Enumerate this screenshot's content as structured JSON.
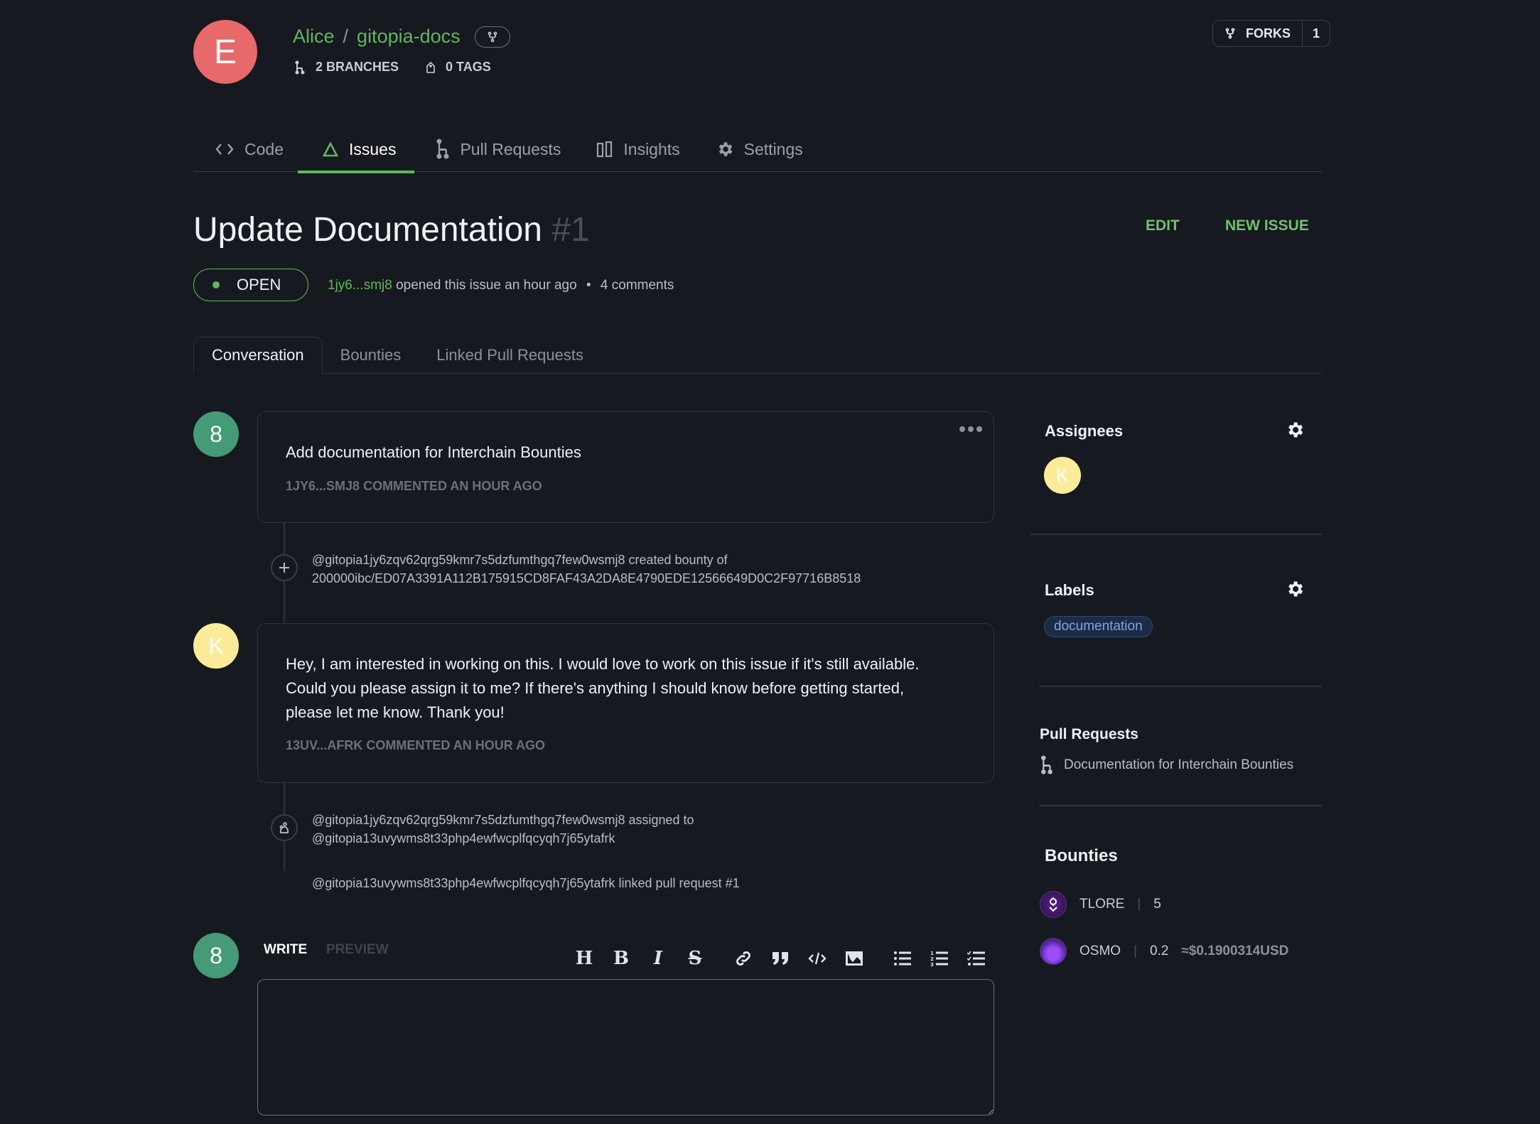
{
  "repo": {
    "avatar_letter": "E",
    "owner": "Alice",
    "separator": "/",
    "name": "gitopia-docs",
    "branches": "2 BRANCHES",
    "tags": "0 TAGS",
    "forks_label": "FORKS",
    "forks_count": "1"
  },
  "nav": {
    "tabs": [
      {
        "label": "Code",
        "icon": "code-icon",
        "active": false
      },
      {
        "label": "Issues",
        "icon": "issue-triangle-icon",
        "active": true
      },
      {
        "label": "Pull Requests",
        "icon": "pull-request-icon",
        "active": false
      },
      {
        "label": "Insights",
        "icon": "insights-icon",
        "active": false
      },
      {
        "label": "Settings",
        "icon": "gear-icon",
        "active": false
      }
    ]
  },
  "issue": {
    "title": "Update Documentation",
    "number": "#1",
    "edit_label": "EDIT",
    "new_issue_label": "NEW ISSUE",
    "status": "OPEN",
    "status_color": "#5fb85a",
    "author": "1jy6...smj8",
    "opened_text": "opened this issue an hour ago",
    "bullet": "•",
    "comments": "4 comments"
  },
  "subtabs": [
    {
      "label": "Conversation",
      "active": true
    },
    {
      "label": "Bounties",
      "active": false
    },
    {
      "label": "Linked Pull Requests",
      "active": false
    }
  ],
  "timeline": {
    "comment1": {
      "avatar": "8",
      "body": "Add documentation for Interchain Bounties",
      "meta": "1JY6...SMJ8 COMMENTED AN HOUR AGO"
    },
    "event_bounty": {
      "icon": "plus-icon",
      "line1": "@gitopia1jy6zqv62qrg59kmr7s5dzfumthgq7few0wsmj8 created bounty of",
      "line2": "200000ibc/ED07A3391A112B175915CD8FAF43A2DA8E4790EDE12566649D0C2F97716B8518"
    },
    "comment2": {
      "avatar": "K",
      "body_lines": [
        "Hey, I am interested in working on this. I would love to work on this issue if it's still available.",
        "Could you please assign it to me? If there's anything I should know before getting started,",
        "please let me know. Thank you!"
      ],
      "meta": "13UV...AFRK COMMENTED AN HOUR AGO"
    },
    "event_assign": {
      "icon": "assign-user-icon",
      "line1": "@gitopia1jy6zqv62qrg59kmr7s5dzfumthgq7few0wsmj8 assigned to",
      "line2": "@gitopia13uvywms8t33php4ewfwcplfqcyqh7j65ytafrk"
    },
    "event_link": {
      "line1": "@gitopia13uvywms8t33php4ewfwcplfqcyqh7j65ytafrk linked pull request #1"
    }
  },
  "editor": {
    "avatar": "8",
    "write_label": "WRITE",
    "preview_label": "PREVIEW",
    "value": "",
    "toolbar": [
      "heading",
      "bold",
      "italic",
      "strikethrough",
      "link",
      "quote",
      "code",
      "image",
      "unordered-list",
      "ordered-list",
      "task-list"
    ]
  },
  "sidebar": {
    "assignees": {
      "title": "Assignees",
      "avatar": "K"
    },
    "labels": {
      "title": "Labels",
      "items": [
        "documentation"
      ]
    },
    "pull_requests": {
      "title": "Pull Requests",
      "items": [
        "Documentation for Interchain Bounties"
      ]
    },
    "bounties": {
      "title": "Bounties",
      "items": [
        {
          "token": "TLORE",
          "amount": "5",
          "usd": ""
        },
        {
          "token": "OSMO",
          "amount": "0.2",
          "usd": "≈$0.1900314USD"
        }
      ]
    }
  }
}
